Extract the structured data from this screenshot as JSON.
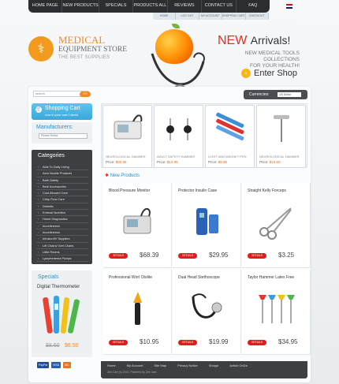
{
  "topnav": [
    "HOME PAGE",
    "NEW PRODUCTS",
    "SPECIALS",
    "PRODUCTS ALL",
    "REVIEWS",
    "CONTACT US",
    "FAQ"
  ],
  "subnav": [
    "HOME",
    "LOG OUT",
    "MY ACCOUNT",
    "SHOPPING CART",
    "CHECKOUT"
  ],
  "logo": {
    "line1": "MEDICAL",
    "line2": "EQUIPMENT STORE",
    "line3": "THE BEST SUPPLIES"
  },
  "hero": {
    "new": "NEW",
    "arrivals": "Arrivals!",
    "sub1": "NEW MEDICAL TOOLS COLLECTIONS",
    "sub2": "FOR YOUR HEALTH!",
    "enter": "Enter Shop"
  },
  "search": {
    "placeholder": "search",
    "button": "GO"
  },
  "cart": {
    "title": "Shopping Cart",
    "sub": "now in your cart 0 items"
  },
  "manufacturers": {
    "title": "Manufacturers:",
    "select": "Please Select"
  },
  "categories": {
    "title": "Categories",
    "items": [
      "Aids To Daily Living",
      "Aero Mobile Products",
      "Bath Safety",
      "Bed/ Accessories",
      "Cost Allowed Care",
      "Crisp Flow Care",
      "Diabetic",
      "Enteral/ Nutrition",
      "Home Diagnostics",
      "Incontinence",
      "Incontinence",
      "Infusion/IV Supplies",
      "Lift Chairs/ Geri Chairs",
      "Little Rooms",
      "Lymphedema Pumps"
    ]
  },
  "specials": {
    "title": "Specials",
    "name": "Digital Thermometer",
    "old": "$8.60",
    "new": "$6.50"
  },
  "currency": {
    "label": "Currencies:",
    "value": "US Dollar"
  },
  "carousel": [
    {
      "name": "NEUROLOGICAL HAMMER",
      "price_label": "Price:",
      "price": "$20.95"
    },
    {
      "name": "ADULT SAFETY HAMMER",
      "price_label": "Price:",
      "price": "$12.95"
    },
    {
      "name": "LIGHT AND MAGNET PEN",
      "price_label": "Price:",
      "price": "$9.95"
    },
    {
      "name": "NEUROLOGICAL HAMMER",
      "price_label": "Price:",
      "price": "$10.60"
    }
  ],
  "new_products": {
    "title": "New Products",
    "items": [
      {
        "name": "Blood Pressure Monitor",
        "details": "DETAILS",
        "price": "$68.39"
      },
      {
        "name": "Protector Insulin Case",
        "details": "DETAILS",
        "price": "$29.95"
      },
      {
        "name": "Straight Kelly Forceps",
        "details": "DETAILS",
        "price": "$3.25"
      },
      {
        "name": "Professional Wnrl Otolite",
        "details": "DETAILS",
        "price": "$10.95"
      },
      {
        "name": "Dual Head Stethoscope",
        "details": "DETAILS",
        "price": "$19.99"
      },
      {
        "name": "Taylor Hammer Latex Free",
        "details": "DETAILS",
        "price": "$34.95"
      }
    ]
  },
  "footer": {
    "links": [
      "Home",
      "My Account",
      "Site Map",
      "Privacy Notice",
      "Shoppl",
      "Action OnDa"
    ],
    "copy": "Zen Cart (c) 2010. Powered by Zen Cart"
  },
  "payment": [
    "PayPal",
    "VISA",
    "MC"
  ],
  "colors": {
    "accent": "#f28a1c",
    "link": "#2a8ec5",
    "dark": "#3d3f42",
    "sale": "#e21b1b"
  }
}
